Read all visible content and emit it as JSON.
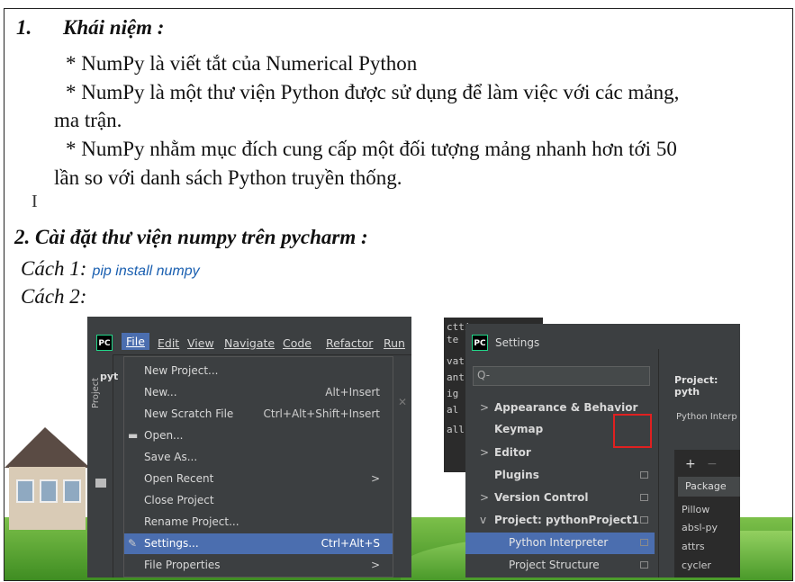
{
  "section1": {
    "number": "1.",
    "title": "Khái niệm :",
    "lines": [
      "* NumPy là viết tắt của Numerical Python",
      "* NumPy là một thư viện Python được sử dụng để làm việc với các mảng,",
      "ma trận.",
      "* NumPy nhằm mục đích cung cấp một đối tượng mảng nhanh hơn tới 50",
      "lần so với danh sách Python truyền thống."
    ]
  },
  "section2": {
    "title": "2. Cài đặt thư viện numpy trên pycharm :",
    "method1_label": "Cách 1:",
    "method1_code": "pip install numpy",
    "method2_label": "Cách 2:"
  },
  "ide_menu": {
    "logo": "PC",
    "menus": [
      "File",
      "Edit",
      "View",
      "Navigate",
      "Code",
      "Refactor",
      "Run"
    ],
    "side_label": "Project",
    "side_text": "pyt",
    "file_items": [
      {
        "label": "New Project...",
        "shortcut": ""
      },
      {
        "label": "New...",
        "shortcut": "Alt+Insert"
      },
      {
        "label": "New Scratch File",
        "shortcut": "Ctrl+Alt+Shift+Insert"
      },
      {
        "label": "Open...",
        "shortcut": ""
      },
      {
        "label": "Save As...",
        "shortcut": ""
      },
      {
        "label": "Open Recent",
        "shortcut": ">"
      },
      {
        "label": "Close Project",
        "shortcut": ""
      },
      {
        "label": "Rename Project...",
        "shortcut": ""
      },
      {
        "label": "Settings...",
        "shortcut": "Ctrl+Alt+S"
      },
      {
        "label": "File Properties",
        "shortcut": ">"
      }
    ]
  },
  "code_snippet": [
    "ctti",
    "te",
    "vat",
    "ant",
    "ig",
    "al",
    "all"
  ],
  "settings": {
    "logo": "PC",
    "title": "Settings",
    "search_placeholder": "Q-",
    "tree": [
      {
        "arrow": ">",
        "label": "Appearance & Behavior"
      },
      {
        "arrow": "",
        "label": "Keymap"
      },
      {
        "arrow": ">",
        "label": "Editor"
      },
      {
        "arrow": "",
        "label": "Plugins"
      },
      {
        "arrow": ">",
        "label": "Version Control"
      },
      {
        "arrow": "v",
        "label": "Project: pythonProject1"
      },
      {
        "arrow": "",
        "label": "Python Interpreter"
      },
      {
        "arrow": "",
        "label": "Project Structure"
      }
    ],
    "project_header": "Project: pyth",
    "interpreter_label": "Python Interp",
    "table_header": "Package",
    "packages": [
      "Pillow",
      "absl-py",
      "attrs",
      "cycler"
    ]
  }
}
